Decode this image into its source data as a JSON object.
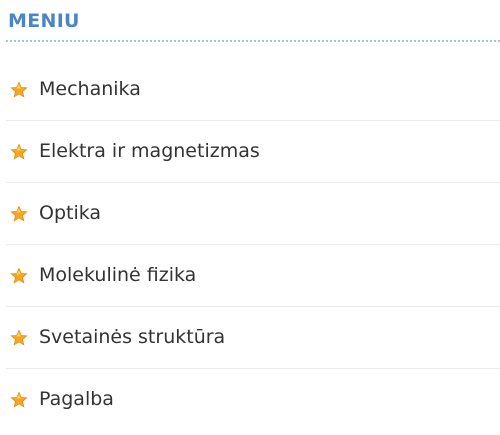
{
  "menu": {
    "title": "MENIU",
    "accent_color": "#4a86c5",
    "icon": "star-icon",
    "items": [
      {
        "label": "Mechanika"
      },
      {
        "label": "Elektra ir magnetizmas"
      },
      {
        "label": "Optika"
      },
      {
        "label": "Molekulinė fizika"
      },
      {
        "label": "Svetainės struktūra"
      },
      {
        "label": "Pagalba"
      }
    ]
  }
}
